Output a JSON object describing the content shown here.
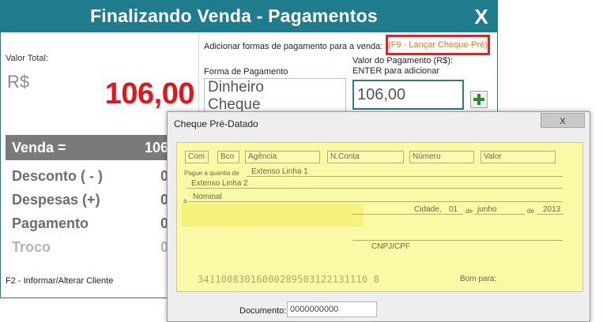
{
  "main_window": {
    "title": "Finalizando Venda - Pagamentos",
    "close_label": "X",
    "valor_total_label": "Valor Total:",
    "currency": "R$",
    "valor_total": "106,00",
    "summary": {
      "venda_label": "Venda =",
      "venda_value": "106",
      "rows": [
        {
          "label": "Desconto ( - )",
          "value": "0"
        },
        {
          "label": "Despesas (+)",
          "value": "0"
        },
        {
          "label": "Pagamento",
          "value": "0"
        },
        {
          "label": "Troco",
          "value": "0"
        }
      ]
    },
    "f2_hint": "F2 - Informar/Alterar Cliente",
    "adicionar_label": "Adicionar formas de pagamento para a venda:",
    "f9_button": "(F9 - Lançar Cheque-Pré)",
    "forma_label": "Forma de Pagamento",
    "valor_pagamento_label_1": "Valor do Pagamento (R$):",
    "valor_pagamento_label_2": "ENTER para adicionar",
    "formas": [
      "Dinheiro",
      "Cheque"
    ],
    "valor_pagamento": "106,00",
    "colors": {
      "title_bar": "#1f7c8c",
      "total": "#e8121a",
      "f9_border": "#e32127",
      "f9_text": "#e8771a"
    }
  },
  "cheque_dialog": {
    "title": "Cheque Pré-Datado",
    "close_label": "x",
    "fields": {
      "com": "Com",
      "bco": "Bco",
      "agencia": "Agência",
      "nconta": "N.Conta",
      "numero": "Número",
      "valor": "Valor"
    },
    "pague_label": "Pague a quantia de",
    "extenso_1": "Extenso Linha 1",
    "extenso_2": "Extenso Linha 2",
    "a_label": "a",
    "nominal": "Nominal",
    "cidade": "Cidade,",
    "dia": "01",
    "de1": "de",
    "mes": "junho",
    "de2": "de",
    "ano": "2013",
    "cnpj_label": "CNPJ/CPF",
    "micr": "34110083016000289503122131110 8",
    "bom_para": "Bom para:",
    "documento_label": "Documento:",
    "documento_value": "0000000000",
    "colors": {
      "cheque_bg": "#fafaa6",
      "highlight": "#f7f27a"
    }
  }
}
